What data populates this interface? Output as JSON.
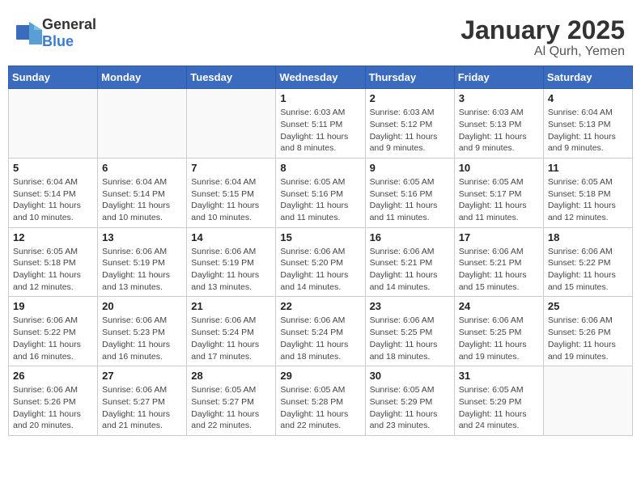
{
  "header": {
    "logo_general": "General",
    "logo_blue": "Blue",
    "title": "January 2025",
    "subtitle": "Al Qurh, Yemen"
  },
  "days_of_week": [
    "Sunday",
    "Monday",
    "Tuesday",
    "Wednesday",
    "Thursday",
    "Friday",
    "Saturday"
  ],
  "weeks": [
    [
      {
        "day": "",
        "info": ""
      },
      {
        "day": "",
        "info": ""
      },
      {
        "day": "",
        "info": ""
      },
      {
        "day": "1",
        "info": "Sunrise: 6:03 AM\nSunset: 5:11 PM\nDaylight: 11 hours\nand 8 minutes."
      },
      {
        "day": "2",
        "info": "Sunrise: 6:03 AM\nSunset: 5:12 PM\nDaylight: 11 hours\nand 9 minutes."
      },
      {
        "day": "3",
        "info": "Sunrise: 6:03 AM\nSunset: 5:13 PM\nDaylight: 11 hours\nand 9 minutes."
      },
      {
        "day": "4",
        "info": "Sunrise: 6:04 AM\nSunset: 5:13 PM\nDaylight: 11 hours\nand 9 minutes."
      }
    ],
    [
      {
        "day": "5",
        "info": "Sunrise: 6:04 AM\nSunset: 5:14 PM\nDaylight: 11 hours\nand 10 minutes."
      },
      {
        "day": "6",
        "info": "Sunrise: 6:04 AM\nSunset: 5:14 PM\nDaylight: 11 hours\nand 10 minutes."
      },
      {
        "day": "7",
        "info": "Sunrise: 6:04 AM\nSunset: 5:15 PM\nDaylight: 11 hours\nand 10 minutes."
      },
      {
        "day": "8",
        "info": "Sunrise: 6:05 AM\nSunset: 5:16 PM\nDaylight: 11 hours\nand 11 minutes."
      },
      {
        "day": "9",
        "info": "Sunrise: 6:05 AM\nSunset: 5:16 PM\nDaylight: 11 hours\nand 11 minutes."
      },
      {
        "day": "10",
        "info": "Sunrise: 6:05 AM\nSunset: 5:17 PM\nDaylight: 11 hours\nand 11 minutes."
      },
      {
        "day": "11",
        "info": "Sunrise: 6:05 AM\nSunset: 5:18 PM\nDaylight: 11 hours\nand 12 minutes."
      }
    ],
    [
      {
        "day": "12",
        "info": "Sunrise: 6:05 AM\nSunset: 5:18 PM\nDaylight: 11 hours\nand 12 minutes."
      },
      {
        "day": "13",
        "info": "Sunrise: 6:06 AM\nSunset: 5:19 PM\nDaylight: 11 hours\nand 13 minutes."
      },
      {
        "day": "14",
        "info": "Sunrise: 6:06 AM\nSunset: 5:19 PM\nDaylight: 11 hours\nand 13 minutes."
      },
      {
        "day": "15",
        "info": "Sunrise: 6:06 AM\nSunset: 5:20 PM\nDaylight: 11 hours\nand 14 minutes."
      },
      {
        "day": "16",
        "info": "Sunrise: 6:06 AM\nSunset: 5:21 PM\nDaylight: 11 hours\nand 14 minutes."
      },
      {
        "day": "17",
        "info": "Sunrise: 6:06 AM\nSunset: 5:21 PM\nDaylight: 11 hours\nand 15 minutes."
      },
      {
        "day": "18",
        "info": "Sunrise: 6:06 AM\nSunset: 5:22 PM\nDaylight: 11 hours\nand 15 minutes."
      }
    ],
    [
      {
        "day": "19",
        "info": "Sunrise: 6:06 AM\nSunset: 5:22 PM\nDaylight: 11 hours\nand 16 minutes."
      },
      {
        "day": "20",
        "info": "Sunrise: 6:06 AM\nSunset: 5:23 PM\nDaylight: 11 hours\nand 16 minutes."
      },
      {
        "day": "21",
        "info": "Sunrise: 6:06 AM\nSunset: 5:24 PM\nDaylight: 11 hours\nand 17 minutes."
      },
      {
        "day": "22",
        "info": "Sunrise: 6:06 AM\nSunset: 5:24 PM\nDaylight: 11 hours\nand 18 minutes."
      },
      {
        "day": "23",
        "info": "Sunrise: 6:06 AM\nSunset: 5:25 PM\nDaylight: 11 hours\nand 18 minutes."
      },
      {
        "day": "24",
        "info": "Sunrise: 6:06 AM\nSunset: 5:25 PM\nDaylight: 11 hours\nand 19 minutes."
      },
      {
        "day": "25",
        "info": "Sunrise: 6:06 AM\nSunset: 5:26 PM\nDaylight: 11 hours\nand 19 minutes."
      }
    ],
    [
      {
        "day": "26",
        "info": "Sunrise: 6:06 AM\nSunset: 5:26 PM\nDaylight: 11 hours\nand 20 minutes."
      },
      {
        "day": "27",
        "info": "Sunrise: 6:06 AM\nSunset: 5:27 PM\nDaylight: 11 hours\nand 21 minutes."
      },
      {
        "day": "28",
        "info": "Sunrise: 6:05 AM\nSunset: 5:27 PM\nDaylight: 11 hours\nand 22 minutes."
      },
      {
        "day": "29",
        "info": "Sunrise: 6:05 AM\nSunset: 5:28 PM\nDaylight: 11 hours\nand 22 minutes."
      },
      {
        "day": "30",
        "info": "Sunrise: 6:05 AM\nSunset: 5:29 PM\nDaylight: 11 hours\nand 23 minutes."
      },
      {
        "day": "31",
        "info": "Sunrise: 6:05 AM\nSunset: 5:29 PM\nDaylight: 11 hours\nand 24 minutes."
      },
      {
        "day": "",
        "info": ""
      }
    ]
  ]
}
